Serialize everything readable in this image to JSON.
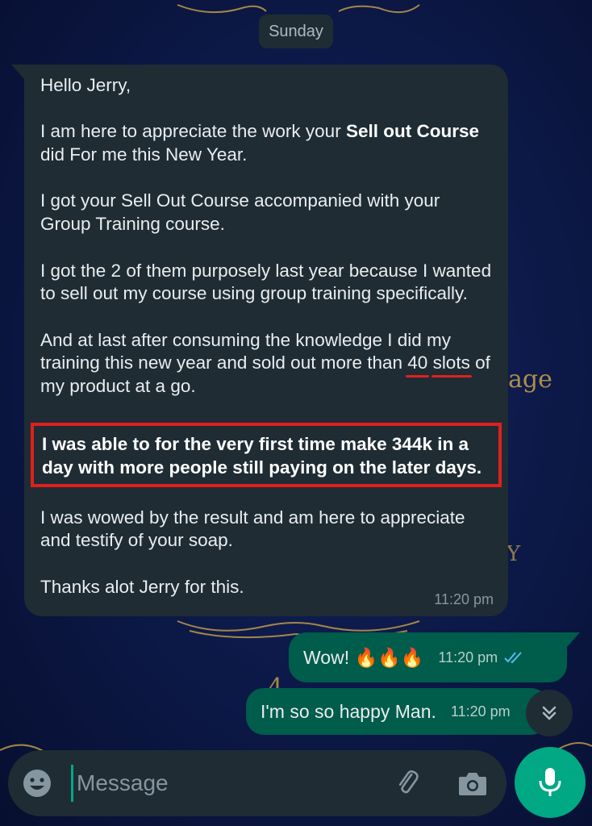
{
  "chat": {
    "date_label": "Sunday",
    "incoming": {
      "greeting": "Hello Jerry,",
      "p1_pre": "I am here to appreciate the work your ",
      "p1_bold": "Sell out Course",
      "p1_post": " did For me this New Year.",
      "p2": "I got your Sell Out Course accompanied with your Group Training course.",
      "p3": "I got the 2 of them purposely last year because I wanted to sell out my course using group training specifically.",
      "p4_pre": "And at last after consuming the knowledge I did my training this new year and sold out more than ",
      "p4_underline1": "40",
      "p4_underline2": "slots",
      "p4_post": " of my product at a go.",
      "highlight": "I was able to for the very first time make 344k in a day with more people still paying on the later days.",
      "p5": "I was wowed by the result and am here to appreciate and testify of your soap.",
      "p6": "Thanks alot Jerry for this.",
      "time": "11:20 pm"
    },
    "outgoing": [
      {
        "text": "Wow! 🔥🔥🔥",
        "time": "11:20 pm"
      },
      {
        "text": "I'm so so happy Man.",
        "time": "11:20 pm"
      }
    ]
  },
  "composer": {
    "placeholder": "Message"
  },
  "colors": {
    "incoming_bubble": "#1f2c34",
    "outgoing_bubble": "#005c4b",
    "accent": "#00a884",
    "read_ticks": "#53bdeb",
    "annotation_red": "#e0201e"
  },
  "icons": [
    "emoji-icon",
    "paperclip-icon",
    "camera-icon",
    "microphone-icon",
    "chevron-double-down-icon",
    "double-check-icon"
  ]
}
